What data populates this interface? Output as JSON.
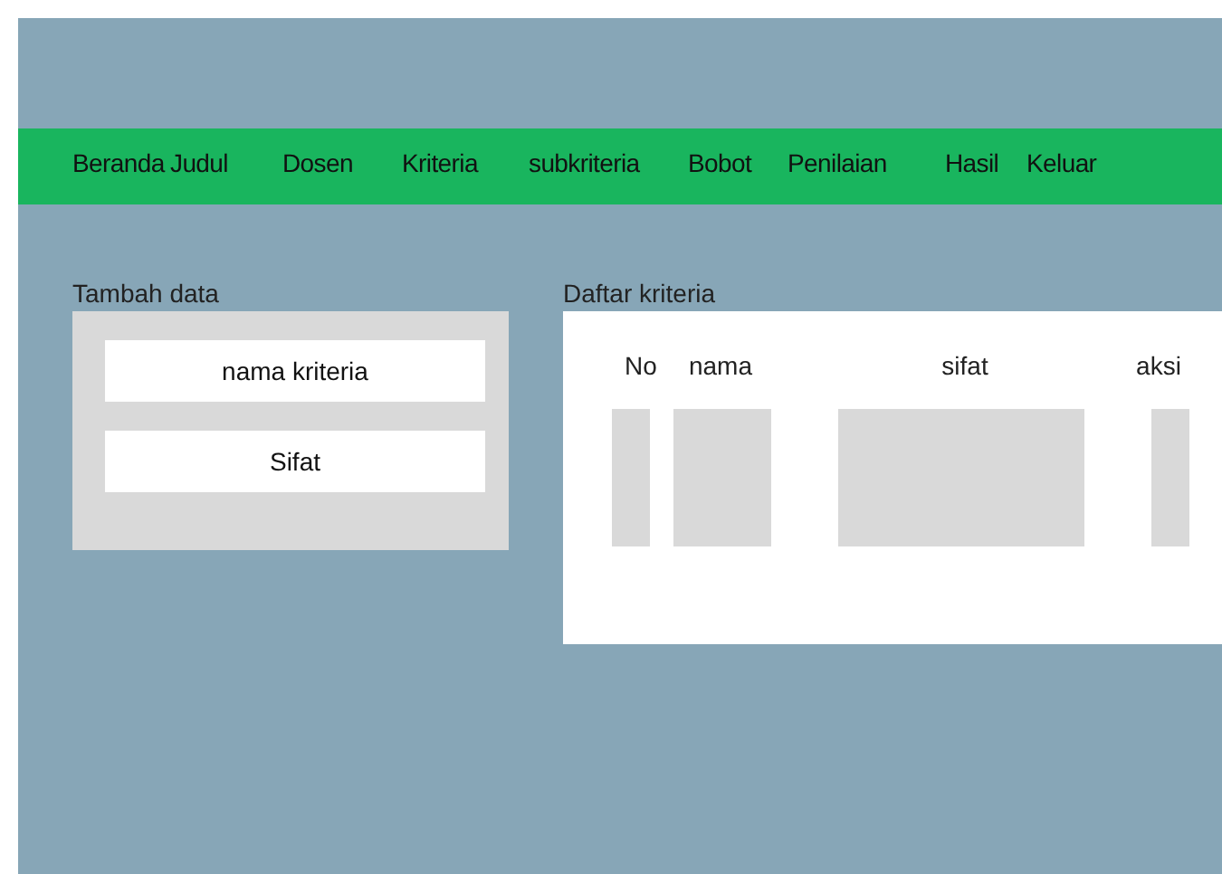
{
  "nav": {
    "items": [
      {
        "label": "Beranda"
      },
      {
        "label": "Judul"
      },
      {
        "label": "Dosen"
      },
      {
        "label": "Kriteria"
      },
      {
        "label": "subkriteria"
      },
      {
        "label": "Bobot"
      },
      {
        "label": "Penilaian"
      },
      {
        "label": "Hasil"
      },
      {
        "label": "Keluar"
      }
    ]
  },
  "form": {
    "title": "Tambah data",
    "fields": [
      {
        "placeholder": "nama kriteria"
      },
      {
        "placeholder": "Sifat"
      }
    ]
  },
  "table": {
    "title": "Daftar kriteria",
    "columns": [
      "No",
      "nama",
      "sifat",
      "aksi"
    ]
  }
}
